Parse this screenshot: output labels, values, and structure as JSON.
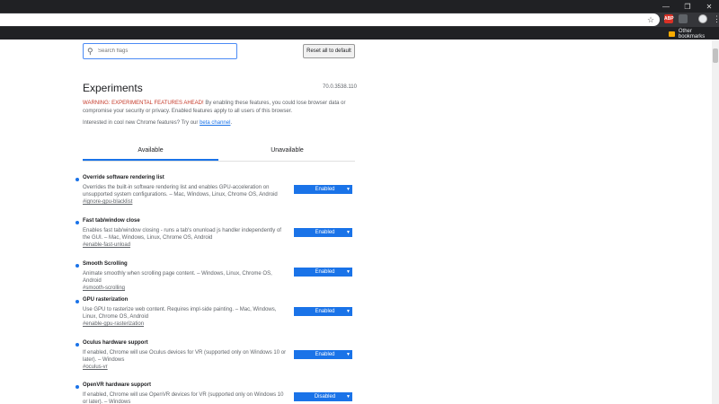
{
  "browser": {
    "bookmark_folder": "Other bookmarks"
  },
  "page": {
    "search_placeholder": "Search flags",
    "reset_label": "Reset all to default",
    "title": "Experiments",
    "version": "70.0.3538.110",
    "warning_prefix": "WARNING: EXPERIMENTAL FEATURES AHEAD!",
    "warning_rest": " By enabling these features, you could lose browser data or compromise your security or privacy. Enabled features apply to all users of this browser.",
    "interested_text": "Interested in cool new Chrome features? Try our ",
    "beta_link": "beta channel",
    "interested_suffix": ".",
    "tabs": [
      {
        "label": "Available"
      },
      {
        "label": "Unavailable"
      }
    ]
  },
  "experiments": [
    {
      "name": "Override software rendering list",
      "desc": "Overrides the built-in software rendering list and enables GPU-acceleration on unsupported system configurations. – Mac, Windows, Linux, Chrome OS, Android",
      "link": "#ignore-gpu-blacklist",
      "state": "Enabled"
    },
    {
      "name": "Fast tab/window close",
      "desc": "Enables fast tab/window closing - runs a tab's onunload js handler independently of the GUI. – Mac, Windows, Linux, Chrome OS, Android",
      "link": "#enable-fast-unload",
      "state": "Enabled"
    },
    {
      "name": "Smooth Scrolling",
      "desc": "Animate smoothly when scrolling page content. – Windows, Linux, Chrome OS, Android",
      "link": "#smooth-scrolling",
      "state": "Enabled"
    },
    {
      "name": "GPU rasterization",
      "desc": "Use GPU to rasterize web content. Requires impl-side painting. – Mac, Windows, Linux, Chrome OS, Android",
      "link": "#enable-gpu-rasterization",
      "state": "Enabled"
    },
    {
      "name": "Oculus hardware support",
      "desc": "If enabled, Chrome will use Oculus devices for VR (supported only on Windows 10 or later). – Windows",
      "link": "#oculus-vr",
      "state": "Enabled"
    },
    {
      "name": "OpenVR hardware support",
      "desc": "If enabled, Chrome will use OpenVR devices for VR (supported only on Windows 10 or later). – Windows",
      "link": "",
      "state": "Disabled"
    }
  ],
  "colors": {
    "accent": "#1a73e8",
    "warning_red": "#c53929"
  }
}
